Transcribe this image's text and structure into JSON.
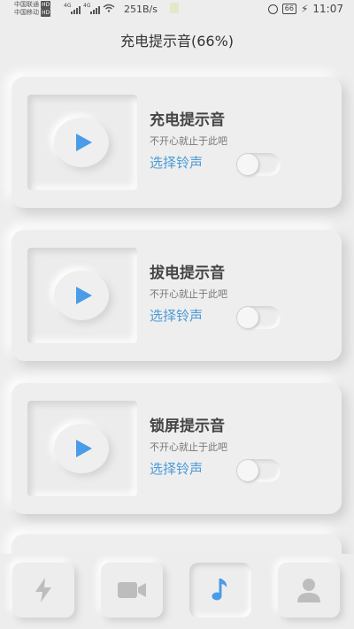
{
  "status_bar": {
    "carrier1": "中国联通",
    "carrier2": "中国移动",
    "carrier_badge": "HD",
    "network": "4G",
    "net_speed": "251B/s",
    "battery": "66",
    "time": "11:07"
  },
  "page_title": "充电提示音(66%)",
  "cards": [
    {
      "title": "充电提示音",
      "subtitle": "不开心就止于此吧",
      "link": "选择铃声",
      "toggle_on": false
    },
    {
      "title": "拔电提示音",
      "subtitle": "不开心就止于此吧",
      "link": "选择铃声",
      "toggle_on": false
    },
    {
      "title": "锁屏提示音",
      "subtitle": "不开心就止于此吧",
      "link": "选择铃声",
      "toggle_on": false
    }
  ],
  "bottom_nav": {
    "items": [
      {
        "icon": "lightning-icon",
        "active": false
      },
      {
        "icon": "video-camera-icon",
        "active": false
      },
      {
        "icon": "music-note-icon",
        "active": true
      },
      {
        "icon": "user-icon",
        "active": false
      }
    ],
    "active_color": "#4a9be8",
    "inactive_color": "#bdbdbd"
  },
  "colors": {
    "accent": "#4a9be8",
    "link": "#4a9ad6",
    "background": "#ededed"
  }
}
